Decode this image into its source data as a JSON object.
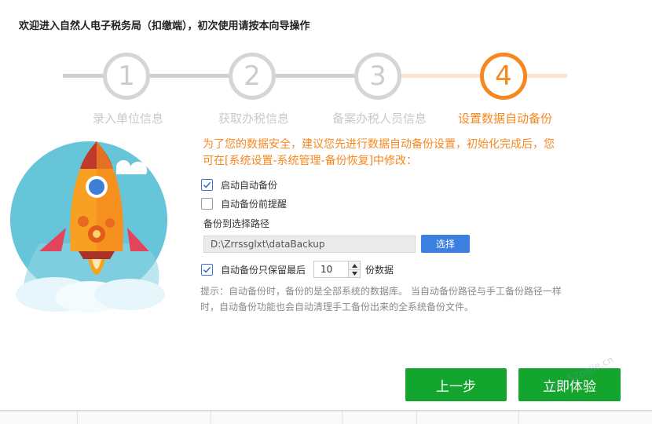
{
  "header": {
    "title": "欢迎进入自然人电子税务局（扣缴端），初次使用请按本向导操作"
  },
  "steps": [
    {
      "num": "1",
      "label": "录入单位信息",
      "active": false
    },
    {
      "num": "2",
      "label": "获取办税信息",
      "active": false
    },
    {
      "num": "3",
      "label": "备案办税人员信息",
      "active": false
    },
    {
      "num": "4",
      "label": "设置数据自动备份",
      "active": true
    }
  ],
  "content": {
    "notice": "为了您的数据安全，建议您先进行数据自动备份设置，初始化完成后，您可在[系统设置-系统管理-备份恢复]中修改：",
    "auto_backup": {
      "label": "启动自动备份",
      "checked": true
    },
    "backup_remind": {
      "label": "自动备份前提醒",
      "checked": false
    },
    "path_label": "备份到选择路径",
    "path_value": "D:\\Zrrssglxt\\dataBackup",
    "choose_label": "选择",
    "keep": {
      "label": "自动备份只保留最后",
      "checked": true,
      "value": "10",
      "unit": "份数据"
    },
    "hint": "提示：自动备份时，备份的是全部系统的数据库。 当自动备份路径与手工备份路径一样时，自动备份功能也会自动清理手工备份出来的全系统备份文件。"
  },
  "buttons": {
    "prev": "上一步",
    "go": "立即体验"
  },
  "watermark": "www.52pojie.cn",
  "colors": {
    "accent": "#f7871f",
    "primary_green": "#13a52d",
    "blue": "#3b7fe0"
  },
  "icons": [
    "rocket-illustration",
    "checkbox-checked-icon",
    "checkbox-empty-icon",
    "spin-up-icon",
    "spin-down-icon"
  ]
}
